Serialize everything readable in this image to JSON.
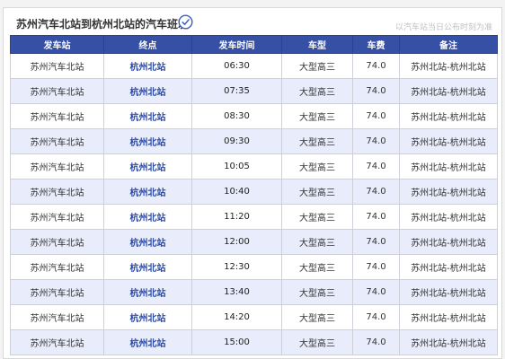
{
  "header": {
    "title": "苏州汽车北站到杭州北站的汽车班次",
    "note": "以汽车站当日公布时刻为准",
    "icon": "clock-icon",
    "accent_color": "#3650a6",
    "row_alt_color": "#e8ecfb"
  },
  "table": {
    "columns": [
      "发车站",
      "终点",
      "发车时间",
      "车型",
      "车费",
      "备注"
    ],
    "rows": [
      [
        "苏州汽车北站",
        "杭州北站",
        "06:30",
        "大型高三",
        "74.0",
        "苏州北站-杭州北站"
      ],
      [
        "苏州汽车北站",
        "杭州北站",
        "07:35",
        "大型高三",
        "74.0",
        "苏州北站-杭州北站"
      ],
      [
        "苏州汽车北站",
        "杭州北站",
        "08:30",
        "大型高三",
        "74.0",
        "苏州北站-杭州北站"
      ],
      [
        "苏州汽车北站",
        "杭州北站",
        "09:30",
        "大型高三",
        "74.0",
        "苏州北站-杭州北站"
      ],
      [
        "苏州汽车北站",
        "杭州北站",
        "10:05",
        "大型高三",
        "74.0",
        "苏州北站-杭州北站"
      ],
      [
        "苏州汽车北站",
        "杭州北站",
        "10:40",
        "大型高三",
        "74.0",
        "苏州北站-杭州北站"
      ],
      [
        "苏州汽车北站",
        "杭州北站",
        "11:20",
        "大型高三",
        "74.0",
        "苏州北站-杭州北站"
      ],
      [
        "苏州汽车北站",
        "杭州北站",
        "12:00",
        "大型高三",
        "74.0",
        "苏州北站-杭州北站"
      ],
      [
        "苏州汽车北站",
        "杭州北站",
        "12:30",
        "大型高三",
        "74.0",
        "苏州北站-杭州北站"
      ],
      [
        "苏州汽车北站",
        "杭州北站",
        "13:40",
        "大型高三",
        "74.0",
        "苏州北站-杭州北站"
      ],
      [
        "苏州汽车北站",
        "杭州北站",
        "14:20",
        "大型高三",
        "74.0",
        "苏州北站-杭州北站"
      ],
      [
        "苏州汽车北站",
        "杭州北站",
        "15:00",
        "大型高三",
        "74.0",
        "苏州北站-杭州北站"
      ]
    ]
  }
}
